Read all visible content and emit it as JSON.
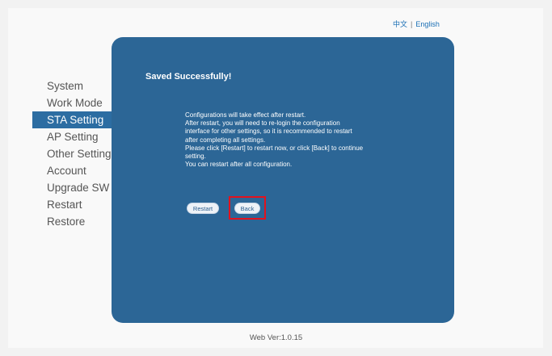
{
  "language": {
    "chinese": "中文",
    "separator": "|",
    "english": "English"
  },
  "sidebar": {
    "items": [
      {
        "label": "System"
      },
      {
        "label": "Work Mode"
      },
      {
        "label": "STA Setting",
        "active": true
      },
      {
        "label": "AP Setting"
      },
      {
        "label": "Other Setting"
      },
      {
        "label": "Account"
      },
      {
        "label": "Upgrade SW"
      },
      {
        "label": "Restart"
      },
      {
        "label": "Restore"
      }
    ]
  },
  "panel": {
    "title": "Saved Successfully!",
    "message_lines": [
      "Configurations will take effect after restart.",
      "After restart, you will need to re-login the configuration",
      "interface for other settings, so it is recommended to restart",
      "after completing all settings.",
      "Please click [Restart] to restart now, or click [Back] to continue",
      "setting.",
      "You can restart after all configuration."
    ],
    "restart_label": "Restart",
    "back_label": "Back"
  },
  "footer": {
    "version": "Web Ver:1.0.15"
  },
  "colors": {
    "panel": "#2c6696",
    "active_nav": "#2c6da2",
    "highlight": "#e3121d",
    "link": "#1a6fb5"
  }
}
